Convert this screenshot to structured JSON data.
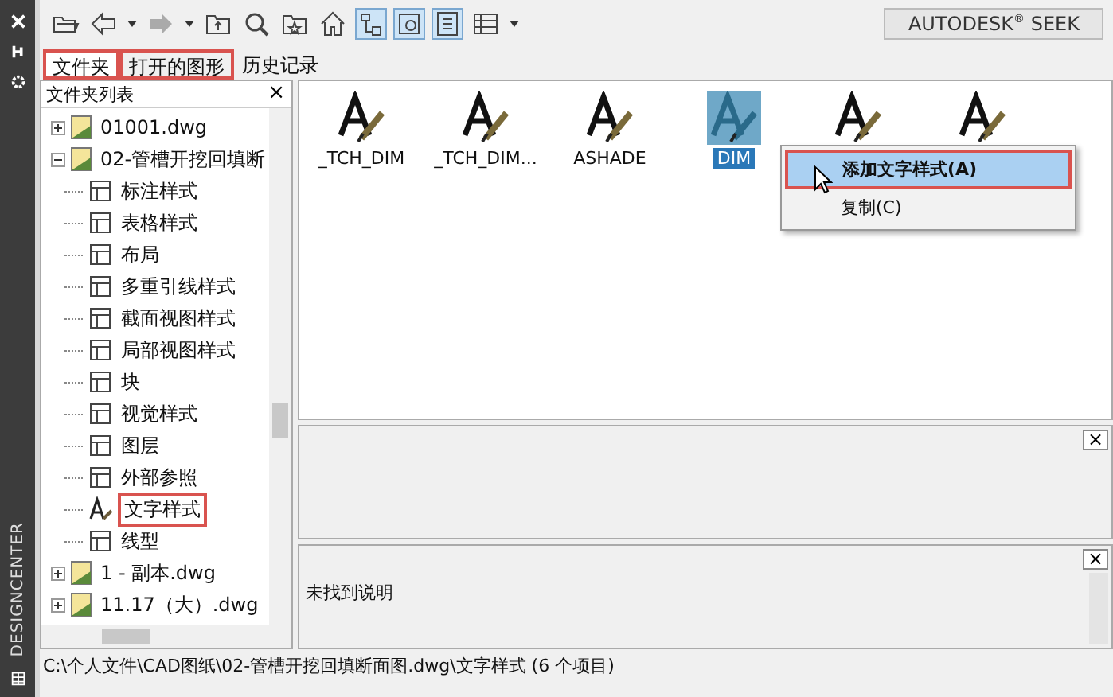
{
  "side_strip": {
    "title": "DESIGNCENTER"
  },
  "toolbar": [
    {
      "kind": "open",
      "pressed": false
    },
    {
      "kind": "back",
      "pressed": false
    },
    {
      "kind": "caret",
      "pressed": false
    },
    {
      "kind": "forward",
      "pressed": false
    },
    {
      "kind": "caret",
      "pressed": false
    },
    {
      "kind": "up",
      "pressed": false
    },
    {
      "kind": "search",
      "pressed": false
    },
    {
      "kind": "favorites",
      "pressed": false
    },
    {
      "kind": "home",
      "pressed": false
    },
    {
      "kind": "tree",
      "pressed": true
    },
    {
      "kind": "preview",
      "pressed": true
    },
    {
      "kind": "description",
      "pressed": true
    },
    {
      "kind": "views",
      "pressed": false
    },
    {
      "kind": "caret",
      "pressed": false
    }
  ],
  "brand": "AUTODESK$^{®}$ SEEK",
  "tabs": [
    {
      "label": "文件夹",
      "selected": true,
      "highlighted": true
    },
    {
      "label": "打开的图形",
      "selected": false,
      "highlighted": true
    },
    {
      "label": "历史记录",
      "selected": false,
      "highlighted": false
    }
  ],
  "folder_pane": {
    "title": "文件夹列表",
    "close": "×",
    "tree": [
      {
        "label": "01001.dwg",
        "kind": "drawing",
        "expanded": false,
        "highlighted": false
      },
      {
        "label": "02-管槽开挖回填断",
        "kind": "drawing",
        "expanded": true,
        "highlighted": false,
        "children": [
          {
            "label": "标注样式",
            "kind": "style",
            "highlighted": false
          },
          {
            "label": "表格样式",
            "kind": "style",
            "highlighted": false
          },
          {
            "label": "布局",
            "kind": "style",
            "highlighted": false
          },
          {
            "label": "多重引线样式",
            "kind": "style",
            "highlighted": false
          },
          {
            "label": "截面视图样式",
            "kind": "style",
            "highlighted": false
          },
          {
            "label": "局部视图样式",
            "kind": "style",
            "highlighted": false
          },
          {
            "label": "块",
            "kind": "style",
            "highlighted": false
          },
          {
            "label": "视觉样式",
            "kind": "style",
            "highlighted": false
          },
          {
            "label": "图层",
            "kind": "style",
            "highlighted": false
          },
          {
            "label": "外部参照",
            "kind": "style",
            "highlighted": false
          },
          {
            "label": "文字样式",
            "kind": "text",
            "highlighted": true
          },
          {
            "label": "线型",
            "kind": "style",
            "highlighted": false
          }
        ]
      },
      {
        "label": "1 - 副本.dwg",
        "kind": "drawing",
        "expanded": false,
        "highlighted": false
      },
      {
        "label": "11.17（大）.dwg",
        "kind": "drawing",
        "expanded": false,
        "highlighted": false
      }
    ]
  },
  "content_items": [
    {
      "label": "_TCH_DIM",
      "selected": false
    },
    {
      "label": "_TCH_DIM...",
      "selected": false
    },
    {
      "label": "ASHADE",
      "selected": false
    },
    {
      "label": "DIM",
      "selected": true
    },
    {
      "selected": false
    },
    {
      "selected": false
    }
  ],
  "context_menu": [
    {
      "label": "添加文字样式(A)",
      "selected": true,
      "highlighted": true
    },
    {
      "label": "复制(C)",
      "selected": false,
      "highlighted": false
    }
  ],
  "preview_pane": {
    "close": "×"
  },
  "description_pane": {
    "close": "×",
    "text": "未找到说明"
  },
  "status_bar": "C:\\个人文件\\CAD图纸\\02-管槽开挖回填断面图.dwg\\文字样式 (6 个项目)"
}
